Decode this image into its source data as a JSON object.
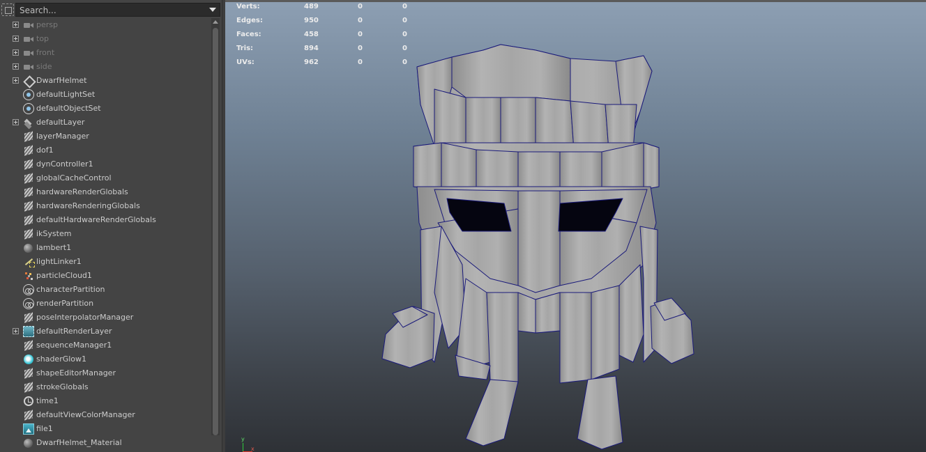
{
  "outliner": {
    "search_placeholder": "Search...",
    "items": [
      {
        "label": "persp",
        "icon": "camera-icon",
        "expandable": true,
        "dim": true
      },
      {
        "label": "top",
        "icon": "camera-icon",
        "expandable": true,
        "dim": true
      },
      {
        "label": "front",
        "icon": "camera-icon",
        "expandable": true,
        "dim": true
      },
      {
        "label": "side",
        "icon": "camera-icon",
        "expandable": true,
        "dim": true
      },
      {
        "label": "DwarfHelmet",
        "icon": "group-icon",
        "expandable": true,
        "dim": false
      },
      {
        "label": "defaultLightSet",
        "icon": "set-icon",
        "expandable": false,
        "dim": false
      },
      {
        "label": "defaultObjectSet",
        "icon": "set-icon",
        "expandable": false,
        "dim": false
      },
      {
        "label": "defaultLayer",
        "icon": "display-layer-icon",
        "expandable": true,
        "dim": false
      },
      {
        "label": "layerManager",
        "icon": "dependency-node-icon",
        "expandable": false,
        "dim": false
      },
      {
        "label": "dof1",
        "icon": "dependency-node-icon",
        "expandable": false,
        "dim": false
      },
      {
        "label": "dynController1",
        "icon": "dependency-node-icon",
        "expandable": false,
        "dim": false
      },
      {
        "label": "globalCacheControl",
        "icon": "dependency-node-icon",
        "expandable": false,
        "dim": false
      },
      {
        "label": "hardwareRenderGlobals",
        "icon": "dependency-node-icon",
        "expandable": false,
        "dim": false
      },
      {
        "label": "hardwareRenderingGlobals",
        "icon": "dependency-node-icon",
        "expandable": false,
        "dim": false
      },
      {
        "label": "defaultHardwareRenderGlobals",
        "icon": "dependency-node-icon",
        "expandable": false,
        "dim": false
      },
      {
        "label": "ikSystem",
        "icon": "dependency-node-icon",
        "expandable": false,
        "dim": false
      },
      {
        "label": "lambert1",
        "icon": "material-sphere-icon",
        "expandable": false,
        "dim": false
      },
      {
        "label": "lightLinker1",
        "icon": "light-linker-icon",
        "expandable": false,
        "dim": false
      },
      {
        "label": "particleCloud1",
        "icon": "particle-cloud-icon",
        "expandable": false,
        "dim": false
      },
      {
        "label": "characterPartition",
        "icon": "partition-icon",
        "expandable": false,
        "dim": false
      },
      {
        "label": "renderPartition",
        "icon": "partition-icon",
        "expandable": false,
        "dim": false
      },
      {
        "label": "poseInterpolatorManager",
        "icon": "dependency-node-icon",
        "expandable": false,
        "dim": false
      },
      {
        "label": "defaultRenderLayer",
        "icon": "render-layer-icon",
        "expandable": true,
        "dim": false
      },
      {
        "label": "sequenceManager1",
        "icon": "dependency-node-icon",
        "expandable": false,
        "dim": false
      },
      {
        "label": "shaderGlow1",
        "icon": "shader-glow-icon",
        "expandable": false,
        "dim": false
      },
      {
        "label": "shapeEditorManager",
        "icon": "dependency-node-icon",
        "expandable": false,
        "dim": false
      },
      {
        "label": "strokeGlobals",
        "icon": "dependency-node-icon",
        "expandable": false,
        "dim": false
      },
      {
        "label": "time1",
        "icon": "clock-icon",
        "expandable": false,
        "dim": false
      },
      {
        "label": "defaultViewColorManager",
        "icon": "dependency-node-icon",
        "expandable": false,
        "dim": false
      },
      {
        "label": "file1",
        "icon": "file-texture-icon",
        "expandable": false,
        "dim": false
      },
      {
        "label": "DwarfHelmet_Material",
        "icon": "material-sphere-icon",
        "expandable": false,
        "dim": false
      }
    ]
  },
  "viewport": {
    "hud": [
      {
        "name": "Verts:",
        "values": [
          "489",
          "0",
          "0"
        ]
      },
      {
        "name": "Edges:",
        "values": [
          "950",
          "0",
          "0"
        ]
      },
      {
        "name": "Faces:",
        "values": [
          "458",
          "0",
          "0"
        ]
      },
      {
        "name": "Tris:",
        "values": [
          "894",
          "0",
          "0"
        ]
      },
      {
        "name": "UVs:",
        "values": [
          "962",
          "0",
          "0"
        ]
      }
    ],
    "axis": {
      "y_label": "y",
      "x_label": "x"
    },
    "colors": {
      "background_top": "#8d9fb3",
      "background_bottom": "#2e3136",
      "mesh_fill": "#a9a9a9",
      "wireframe": "#1a1a7a",
      "axis_y": "#2ecc3a",
      "axis_x": "#e03a2e"
    }
  }
}
